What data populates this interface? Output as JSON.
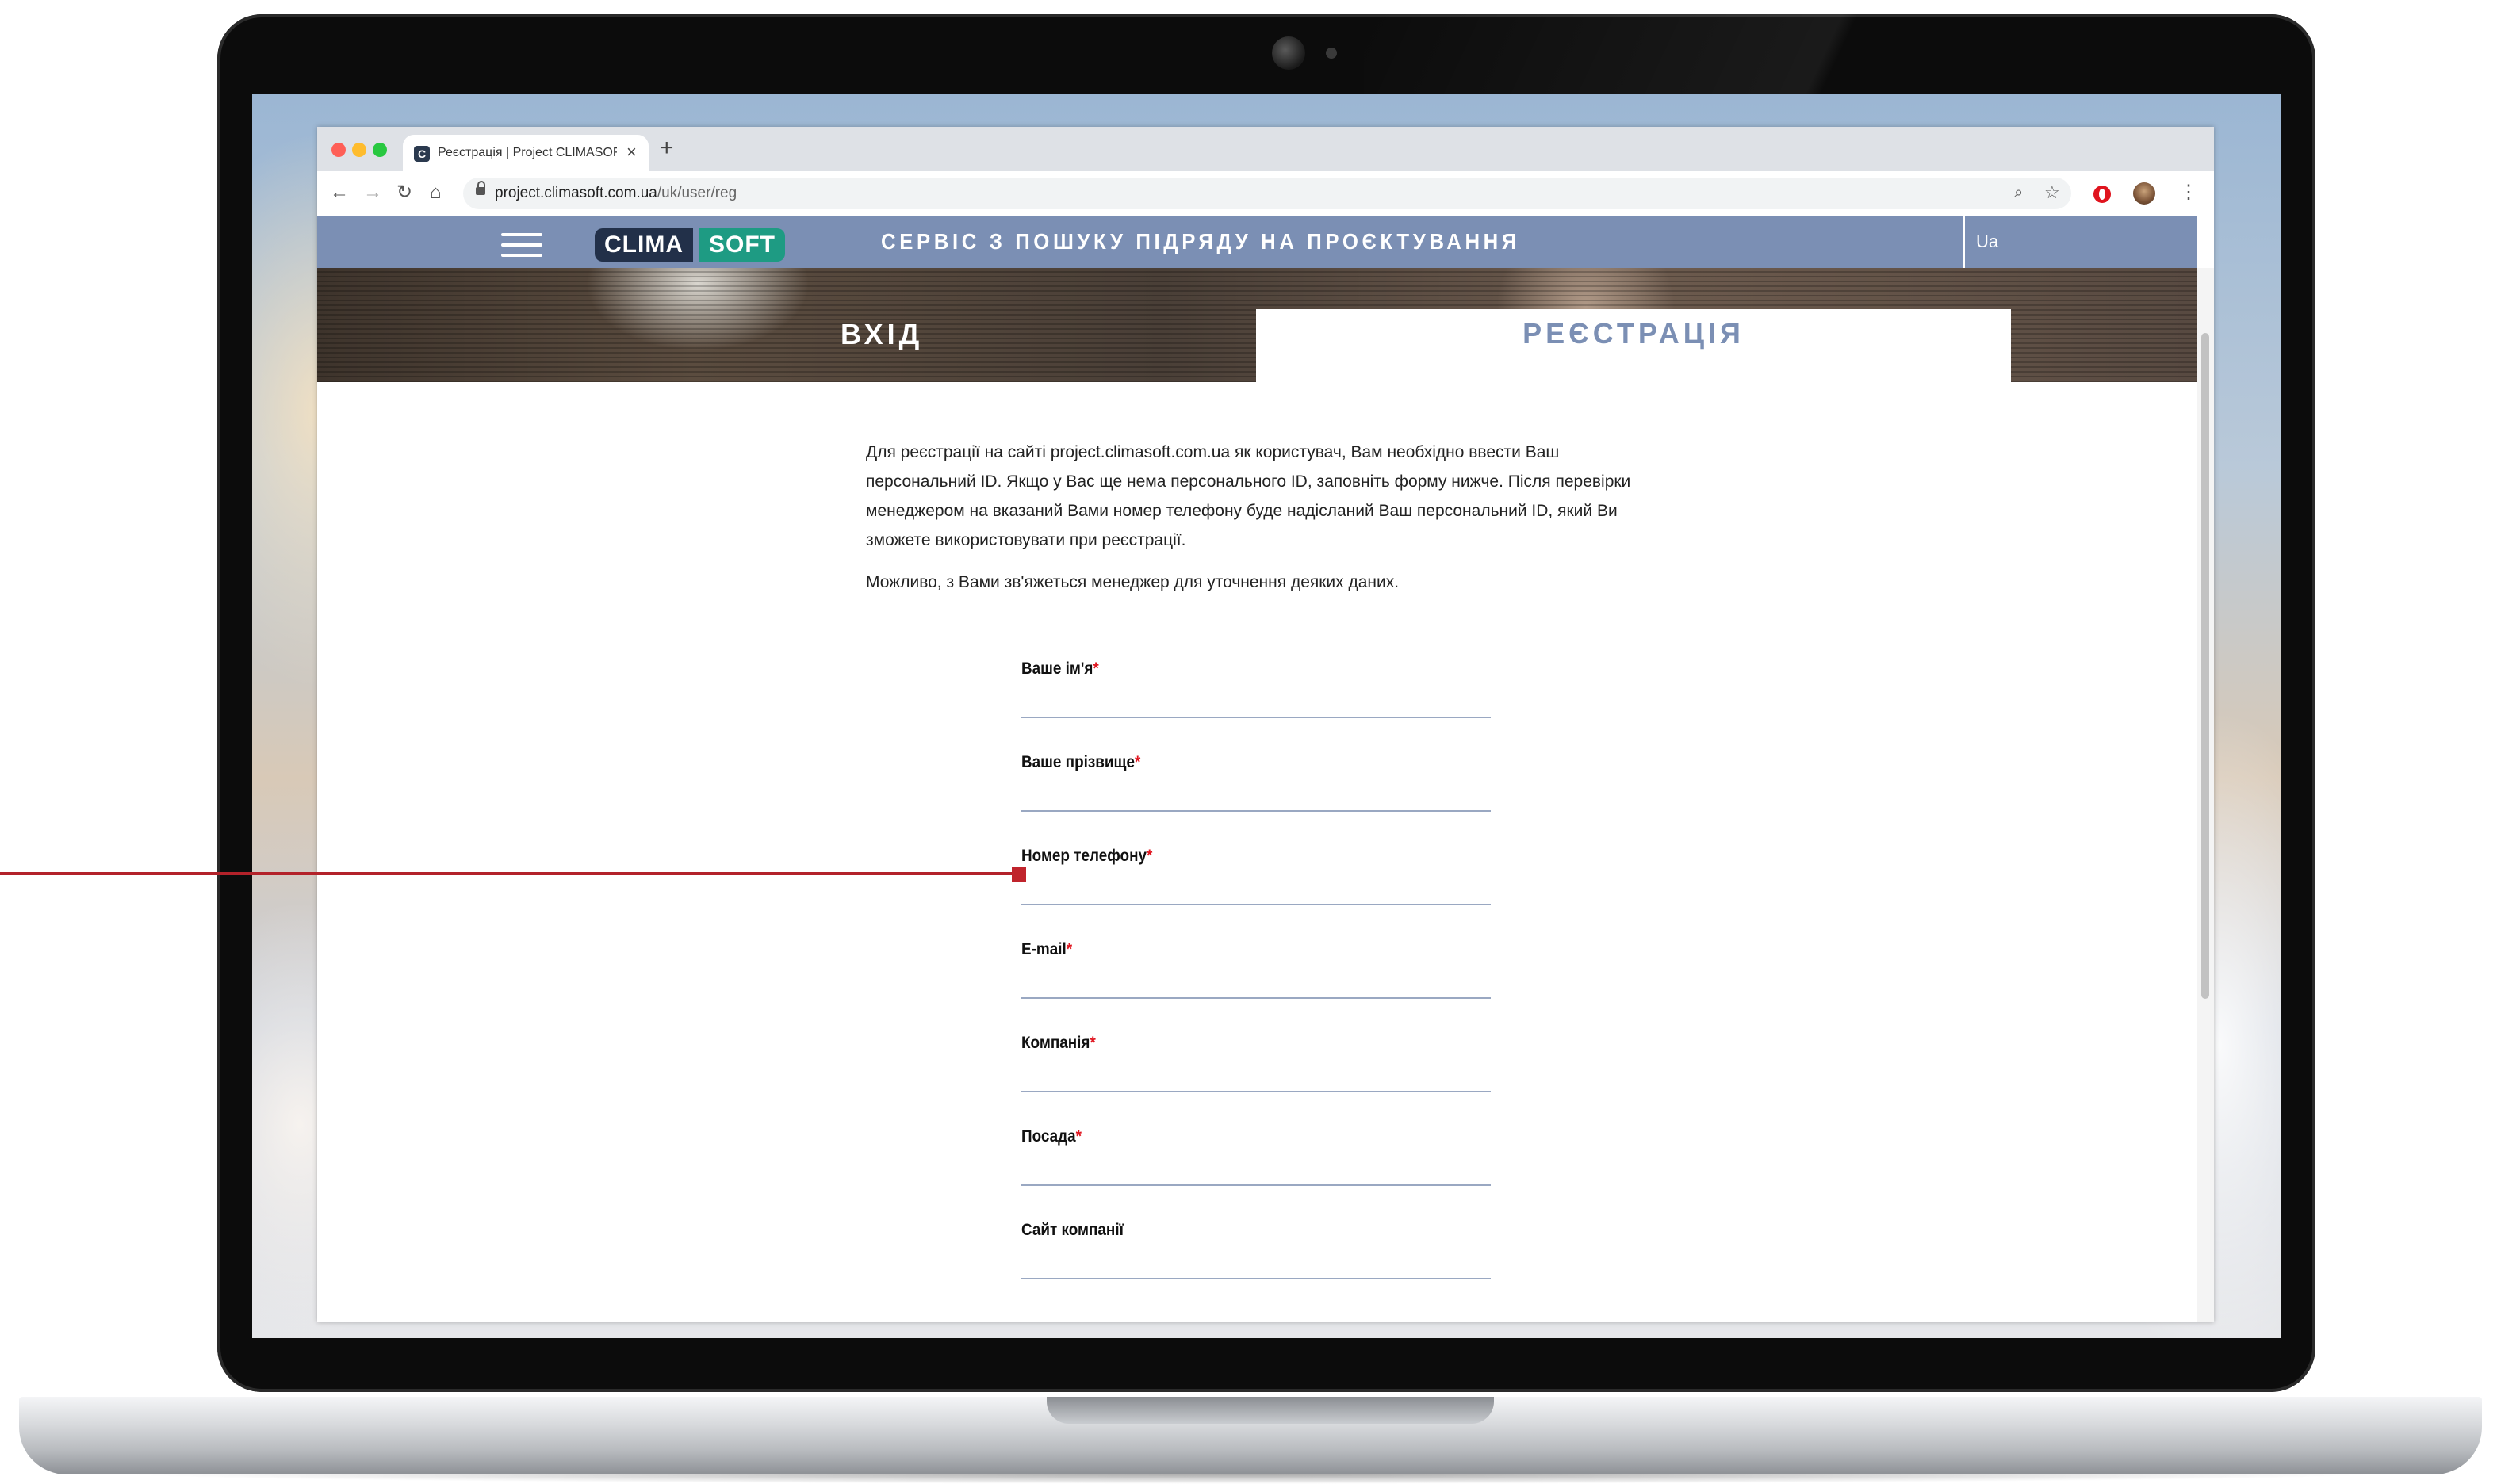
{
  "browser": {
    "tab_title": "Реєстрація | Project CLIMASOFT",
    "tab_favicon": "C",
    "url_host": "project.climasoft.com.ua",
    "url_path": "/uk/user/reg",
    "icons": [
      "back-arrow-icon",
      "forward-arrow-icon",
      "reload-icon",
      "home-icon",
      "lock-icon",
      "zoom-icon",
      "star-icon",
      "opera-icon",
      "avatar-icon",
      "kebab-menu-icon"
    ]
  },
  "header": {
    "logo_left": "CLIMA",
    "logo_right": "SOFT",
    "title": "СЕРВІС З ПОШУКУ ПІДРЯДУ НА ПРОЄКТУВАННЯ",
    "language": "Ua",
    "colors": {
      "header_bg": "#7b8fb4",
      "logo_dark": "#223049",
      "logo_green": "#1e9b83"
    }
  },
  "tabs": {
    "login": "ВХІД",
    "register": "РЕЄСТРАЦІЯ"
  },
  "content": {
    "intro": "Для реєстрації на сайті project.climasoft.com.ua як користувач, Вам необхідно ввести Ваш персональний ID. Якщо у Вас ще нема персонального ID, заповніть форму нижче. Після перевірки менеджером на вказаний Вами номер телефону буде надісланий Ваш персональний ID, який Ви зможете використовувати при реєстрації.",
    "note": "Можливо, з Вами зв'яжеться менеджер для уточнення деяких даних."
  },
  "form": {
    "required_mark": "*",
    "fields": [
      {
        "label": "Ваше ім'я",
        "value": ""
      },
      {
        "label": "Ваше прізвище",
        "value": ""
      },
      {
        "label": "Номер телефону",
        "value": ""
      },
      {
        "label": "E-mail",
        "value": ""
      },
      {
        "label": "Компанія",
        "value": ""
      },
      {
        "label": "Посада",
        "value": ""
      },
      {
        "label": "Сайт компанії",
        "value": ""
      }
    ]
  }
}
